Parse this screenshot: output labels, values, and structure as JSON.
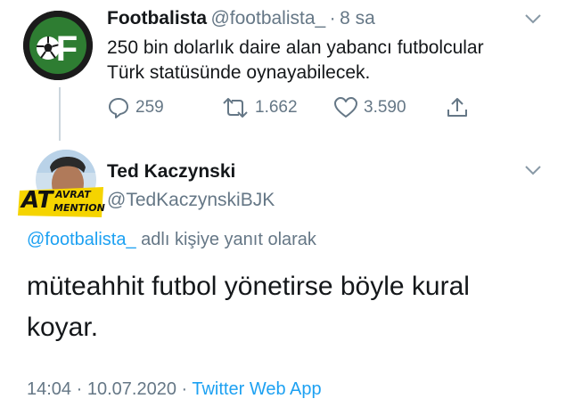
{
  "tweet1": {
    "name": "Footbalista",
    "handle": "@footbalista_",
    "sep": "·",
    "time": "8 sa",
    "text_line1": "250 bin dolarlık daire alan yabancı futbolcular",
    "text_line2": "Türk statüsünde oynayabilecek.",
    "replies": "259",
    "retweets": "1.662",
    "likes": "3.590",
    "avatar_letter": "F",
    "icons": [
      "chevron-down-icon",
      "reply-icon",
      "retweet-icon",
      "like-icon",
      "share-icon"
    ],
    "colors": {
      "avatar_bg": "#2e7d32",
      "avatar_ring": "#1b1b1b"
    }
  },
  "tweet2": {
    "name": "Ted Kaczynski",
    "handle": "@TedKaczynskiBJK",
    "badge_main": "AT",
    "badge_top": "AVRAT",
    "badge_bottom": "MENTION",
    "reply_to_mention": "@footbalista_",
    "reply_to_suffix": " adlı kişiye yanıt olarak",
    "text_line1": "müteahhit futbol yönetirse böyle kural",
    "text_line2": "koyar.",
    "time": "14:04",
    "sep1": " · ",
    "date": "10.07.2020",
    "sep2": " · ",
    "app": "Twitter Web App",
    "colors": {
      "badge_bg": "#f5d400",
      "link": "#1da1f2"
    }
  }
}
